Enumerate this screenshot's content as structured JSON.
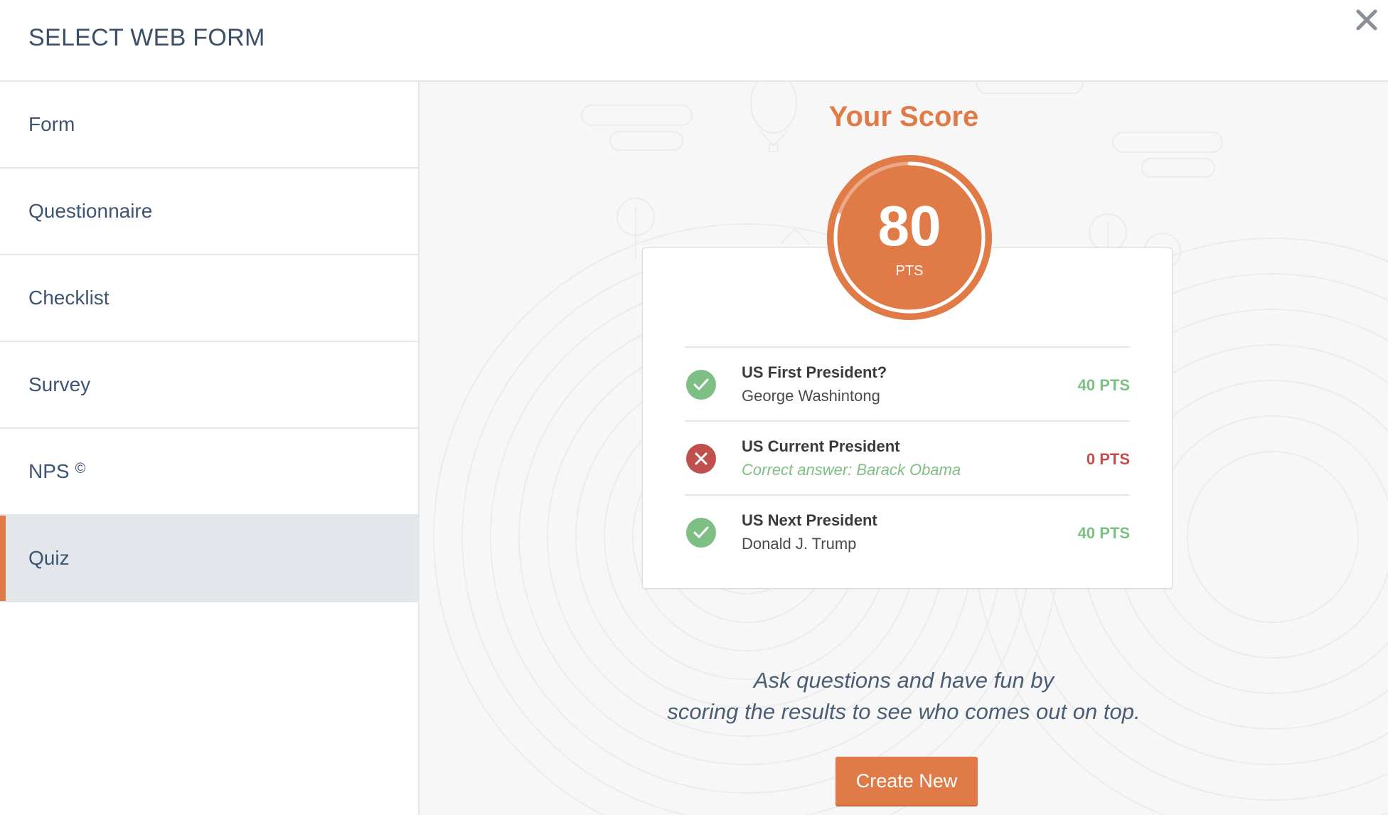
{
  "header": {
    "title": "SELECT WEB FORM",
    "close_icon": "close-icon"
  },
  "sidebar": {
    "items": [
      {
        "label": "Form",
        "active": false
      },
      {
        "label": "Questionnaire",
        "active": false
      },
      {
        "label": "Checklist",
        "active": false
      },
      {
        "label": "Survey",
        "active": false
      },
      {
        "label": "NPS",
        "suffix": "©",
        "active": false
      },
      {
        "label": "Quiz",
        "active": true
      }
    ]
  },
  "preview": {
    "title": "Your Score",
    "score": {
      "value": "80",
      "unit": "PTS",
      "progress": 0.8
    },
    "results": [
      {
        "question": "US First President?",
        "answer": "George Washintong",
        "points": "40 PTS",
        "status": "correct",
        "icon": "check-icon"
      },
      {
        "question": "US Current President",
        "answer": "Correct answer: Barack Obama",
        "points": "0 PTS",
        "status": "wrong",
        "icon": "cross-icon"
      },
      {
        "question": "US Next President",
        "answer": "Donald J. Trump",
        "points": "40 PTS",
        "status": "correct",
        "icon": "check-icon"
      }
    ],
    "tagline_line1": "Ask questions and have fun by",
    "tagline_line2": "scoring the results to see who comes out on top.",
    "create_button": "Create New"
  },
  "colors": {
    "accent": "#e07b47",
    "correct": "#7dbf84",
    "wrong": "#c0504d",
    "text_nav": "#3d5573",
    "active_bg": "#e3e7ec"
  }
}
